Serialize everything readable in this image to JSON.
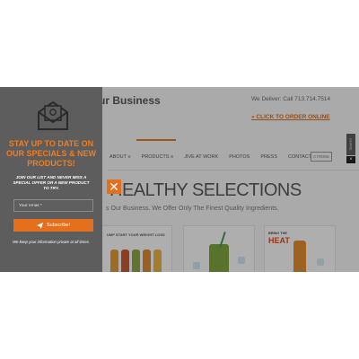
{
  "site": {
    "brand_fragment": "ur Business",
    "deliver_text": "We Deliver: Call 713.714.7514",
    "order_link": "» CLICK TO ORDER ONLINE",
    "nav": [
      "ABOUT ≡",
      "PRODUCTS ≡",
      "JIVE AT WORK",
      "PHOTOS",
      "PRESS",
      "CONTACT"
    ],
    "items_button": "0 ITEMS",
    "side_tab": "SHARE",
    "headline": "HEALTHY SELECTIONS",
    "subline": "s Our Business. We Offer Only The Finest Quality Ingredients.",
    "card1_caption": "UMP START YOUR WEIGHT LOSS",
    "card3_caption_small": "BRING THE",
    "card3_caption_big": "HEAT"
  },
  "popup": {
    "title": "STAY UP TO DATE ON OUR SPECIALS & NEW PRODUCTS!",
    "body": "JOIN OUR LIST AND NEVER MISS A SPECIAL OFFER OR A NEW PRODUCT TO TRY.",
    "email_placeholder": "Your email *",
    "subscribe_label": "Subscribe!",
    "privacy_note": "We keep your information private at all times.",
    "close_glyph": "✕"
  },
  "colors": {
    "accent": "#e4701e",
    "popup_bg": "#5d5d5d"
  },
  "icons": [
    "envelope-icon",
    "paper-plane-icon",
    "close-icon"
  ]
}
